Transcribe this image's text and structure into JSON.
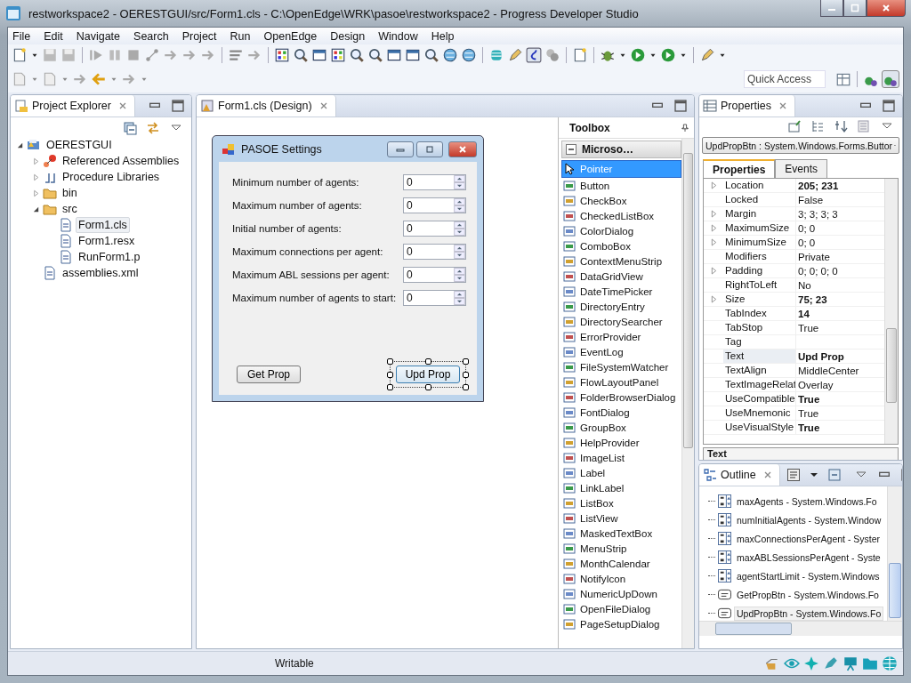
{
  "window": {
    "title": "restworkspace2 - OERESTGUI/src/Form1.cls - C:\\OpenEdge\\WRK\\pasoe\\restworkspace2 - Progress Developer Studio"
  },
  "menu": [
    "File",
    "Edit",
    "Navigate",
    "Search",
    "Project",
    "Run",
    "OpenEdge",
    "Design",
    "Window",
    "Help"
  ],
  "quick_access": {
    "placeholder": "Quick Access"
  },
  "project_explorer": {
    "title": "Project Explorer",
    "tree": [
      {
        "label": "OERESTGUI",
        "kind": "project",
        "expanded": true,
        "selected": false,
        "children": [
          {
            "label": "Referenced Assemblies",
            "kind": "assembly",
            "expanded": false,
            "selected": false
          },
          {
            "label": "Procedure Libraries",
            "kind": "library",
            "expanded": false,
            "selected": false
          },
          {
            "label": "bin",
            "kind": "folder",
            "expanded": false,
            "selected": false
          },
          {
            "label": "src",
            "kind": "folder",
            "expanded": true,
            "selected": false,
            "children": [
              {
                "label": "Form1.cls",
                "kind": "file",
                "selected": true
              },
              {
                "label": "Form1.resx",
                "kind": "file",
                "selected": false
              },
              {
                "label": "RunForm1.p",
                "kind": "file",
                "selected": false
              }
            ]
          },
          {
            "label": "assemblies.xml",
            "kind": "file",
            "selected": false
          }
        ]
      }
    ]
  },
  "editor": {
    "tab": "Form1.cls (Design)",
    "form": {
      "title": "PASOE Settings",
      "fields": [
        {
          "label": "Minimum number of agents:",
          "value": "0"
        },
        {
          "label": "Maximum number of agents:",
          "value": "0"
        },
        {
          "label": "Initial number of agents:",
          "value": "0"
        },
        {
          "label": "Maximum connections per agent:",
          "value": "0"
        },
        {
          "label": "Maximum ABL sessions per agent:",
          "value": "0"
        },
        {
          "label": "Maximum number of agents to start:",
          "value": "0"
        }
      ],
      "buttons": [
        {
          "label": "Get Prop",
          "selected": false
        },
        {
          "label": "Upd Prop",
          "selected": true
        }
      ]
    }
  },
  "toolbox": {
    "title": "Toolbox",
    "group": "Microso…",
    "items": [
      {
        "label": "Pointer",
        "selected": true
      },
      {
        "label": "Button",
        "selected": false
      },
      {
        "label": "CheckBox",
        "selected": false
      },
      {
        "label": "CheckedListBox",
        "selected": false
      },
      {
        "label": "ColorDialog",
        "selected": false
      },
      {
        "label": "ComboBox",
        "selected": false
      },
      {
        "label": "ContextMenuStrip",
        "selected": false
      },
      {
        "label": "DataGridView",
        "selected": false
      },
      {
        "label": "DateTimePicker",
        "selected": false
      },
      {
        "label": "DirectoryEntry",
        "selected": false
      },
      {
        "label": "DirectorySearcher",
        "selected": false
      },
      {
        "label": "ErrorProvider",
        "selected": false
      },
      {
        "label": "EventLog",
        "selected": false
      },
      {
        "label": "FileSystemWatcher",
        "selected": false
      },
      {
        "label": "FlowLayoutPanel",
        "selected": false
      },
      {
        "label": "FolderBrowserDialog",
        "selected": false
      },
      {
        "label": "FontDialog",
        "selected": false
      },
      {
        "label": "GroupBox",
        "selected": false
      },
      {
        "label": "HelpProvider",
        "selected": false
      },
      {
        "label": "ImageList",
        "selected": false
      },
      {
        "label": "Label",
        "selected": false
      },
      {
        "label": "LinkLabel",
        "selected": false
      },
      {
        "label": "ListBox",
        "selected": false
      },
      {
        "label": "ListView",
        "selected": false
      },
      {
        "label": "MaskedTextBox",
        "selected": false
      },
      {
        "label": "MenuStrip",
        "selected": false
      },
      {
        "label": "MonthCalendar",
        "selected": false
      },
      {
        "label": "NotifyIcon",
        "selected": false
      },
      {
        "label": "NumericUpDown",
        "selected": false
      },
      {
        "label": "OpenFileDialog",
        "selected": false
      },
      {
        "label": "PageSetupDialog",
        "selected": false
      }
    ]
  },
  "properties": {
    "title": "Properties",
    "target": "UpdPropBtn : System.Windows.Forms.Buttor",
    "tabs": [
      {
        "label": "Properties",
        "selected": true
      },
      {
        "label": "Events",
        "selected": false
      }
    ],
    "rows": [
      {
        "name": "Location",
        "value": "205; 231",
        "bold": true,
        "expandable": true,
        "selected": false
      },
      {
        "name": "Locked",
        "value": "False",
        "bold": false,
        "expandable": false,
        "selected": false
      },
      {
        "name": "Margin",
        "value": "3; 3; 3; 3",
        "bold": false,
        "expandable": true,
        "selected": false
      },
      {
        "name": "MaximumSize",
        "value": "0; 0",
        "bold": false,
        "expandable": true,
        "selected": false
      },
      {
        "name": "MinimumSize",
        "value": "0; 0",
        "bold": false,
        "expandable": true,
        "selected": false
      },
      {
        "name": "Modifiers",
        "value": "Private",
        "bold": false,
        "expandable": false,
        "selected": false
      },
      {
        "name": "Padding",
        "value": "0; 0; 0; 0",
        "bold": false,
        "expandable": true,
        "selected": false
      },
      {
        "name": "RightToLeft",
        "value": "No",
        "bold": false,
        "expandable": false,
        "selected": false
      },
      {
        "name": "Size",
        "value": "75; 23",
        "bold": true,
        "expandable": true,
        "selected": false
      },
      {
        "name": "TabIndex",
        "value": "14",
        "bold": true,
        "expandable": false,
        "selected": false
      },
      {
        "name": "TabStop",
        "value": "True",
        "bold": false,
        "expandable": false,
        "selected": false
      },
      {
        "name": "Tag",
        "expandable": false,
        "selected": false
      },
      {
        "name": "Text",
        "value": "Upd Prop",
        "bold": true,
        "expandable": false,
        "selected": true
      },
      {
        "name": "TextAlign",
        "value": "MiddleCenter",
        "bold": false,
        "expandable": false,
        "selected": false
      },
      {
        "name": "TextImageRelat",
        "value": "Overlay",
        "bold": false,
        "expandable": false,
        "selected": false
      },
      {
        "name": "UseCompatible",
        "value": "True",
        "bold": true,
        "expandable": false,
        "selected": false
      },
      {
        "name": "UseMnemonic",
        "value": "True",
        "bold": false,
        "expandable": false,
        "selected": false
      },
      {
        "name": "UseVisualStyle",
        "value": "True",
        "bold": true,
        "expandable": false,
        "selected": false
      }
    ],
    "description_title": "Text"
  },
  "outline": {
    "title": "Outline",
    "items": [
      {
        "label": "maxAgents - System.Windows.Fo",
        "kind": "numeric",
        "selected": false
      },
      {
        "label": "numInitialAgents - System.Window",
        "kind": "numeric",
        "selected": false
      },
      {
        "label": "maxConnectionsPerAgent - Syster",
        "kind": "numeric",
        "selected": false
      },
      {
        "label": "maxABLSessionsPerAgent - Syste",
        "kind": "numeric",
        "selected": false
      },
      {
        "label": "agentStartLimit - System.Windows",
        "kind": "numeric",
        "selected": false
      },
      {
        "label": "GetPropBtn - System.Windows.Fo",
        "kind": "button",
        "selected": false
      },
      {
        "label": "UpdPropBtn - System.Windows.Fo",
        "kind": "button",
        "selected": true
      }
    ]
  },
  "status_bar": {
    "text": "Writable"
  }
}
